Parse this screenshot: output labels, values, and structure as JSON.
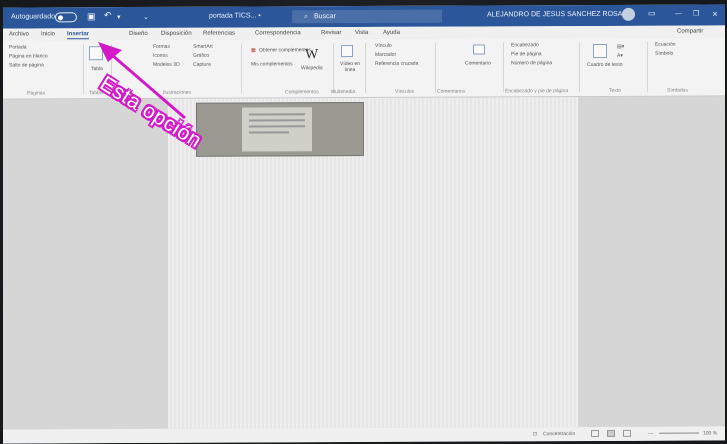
{
  "titlebar": {
    "autosave_label": "Autoguardado",
    "document_name": "portada TICS... •",
    "search_label": "Buscar",
    "user_name": "ALEJANDRO DE JESUS SANCHEZ ROSAS"
  },
  "tabs": [
    "Archivo",
    "Inicio",
    "Insertar",
    "Diseño",
    "Disposición",
    "Referencias",
    "Correspondencia",
    "Revisar",
    "Vista",
    "Ayuda"
  ],
  "active_tab": "Insertar",
  "share_label": "Compartir",
  "ribbon": {
    "pages": {
      "items": [
        "Portada",
        "Página en blanco",
        "Salto de página"
      ],
      "group": "Páginas"
    },
    "tables": {
      "item": "Tabla",
      "group": "Tablas"
    },
    "illustrations": {
      "items": [
        "Formas",
        "Iconos",
        "Modelos 3D",
        "SmartArt",
        "Gráfico",
        "Captura"
      ],
      "group": "Ilustraciones"
    },
    "addins": {
      "items": [
        "Obtener complementos",
        "Mis complementos",
        "Wikipedia"
      ],
      "group": "Complementos"
    },
    "media": {
      "item": "Vídeo en línea",
      "group": "Multimedia"
    },
    "links": {
      "items": [
        "Vínculo",
        "Marcador",
        "Referencia cruzada"
      ],
      "group": "Vínculos"
    },
    "comments": {
      "item": "Comentario",
      "group": "Comentarios"
    },
    "header_footer": {
      "items": [
        "Encabezado",
        "Pie de página",
        "Número de página"
      ],
      "group": "Encabezado y pie de página"
    },
    "text": {
      "item": "Cuadro de texto",
      "group": "Texto"
    },
    "symbols": {
      "items": [
        "Ecuación",
        "Símbolo"
      ],
      "group": "Símbolos"
    }
  },
  "status": {
    "focus_label": "Concentración",
    "zoom": "100 %"
  },
  "annotation": {
    "text": "Esta opción",
    "color": "#d31ac8"
  },
  "colors": {
    "titlebar": "#2b579a",
    "annotation": "#d31ac8"
  }
}
